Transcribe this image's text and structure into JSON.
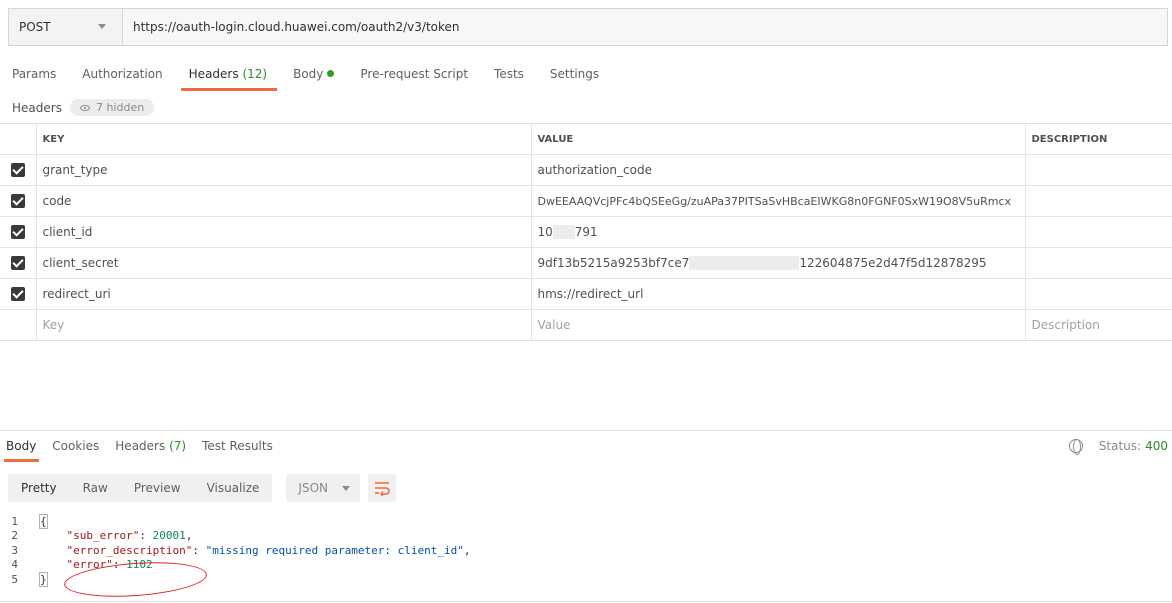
{
  "request": {
    "method": "POST",
    "url": "https://oauth-login.cloud.huawei.com/oauth2/v3/token"
  },
  "tabs": [
    {
      "label": "Params"
    },
    {
      "label": "Authorization"
    },
    {
      "label": "Headers",
      "count": "(12)"
    },
    {
      "label": "Body"
    },
    {
      "label": "Pre-request Script"
    },
    {
      "label": "Tests"
    },
    {
      "label": "Settings"
    }
  ],
  "headers_section": {
    "label": "Headers",
    "hidden": "7 hidden"
  },
  "table": {
    "columns": {
      "key": "KEY",
      "value": "VALUE",
      "description": "DESCRIPTION"
    },
    "rows": [
      {
        "key": "grant_type",
        "value": "authorization_code"
      },
      {
        "key": "code",
        "value": "DwEEAAQVcjPFc4bQSEeGg/zuAPa37PITSaSvHBcaEIWKG8n0FGNF0SxW19O8V5uRmcx"
      },
      {
        "key": "client_id",
        "value_a": "10",
        "value_b": "791"
      },
      {
        "key": "client_secret",
        "value_a": "9df13b5215a9253bf7ce7",
        "value_b": "122604875e2d47f5d12878295"
      },
      {
        "key": "redirect_uri",
        "value": "hms://redirect_url"
      }
    ],
    "placeholders": {
      "key": "Key",
      "value": "Value",
      "description": "Description"
    }
  },
  "response": {
    "tabs": [
      {
        "label": "Body"
      },
      {
        "label": "Cookies"
      },
      {
        "label": "Headers",
        "count": "(7)"
      },
      {
        "label": "Test Results"
      }
    ],
    "status_label": "Status:",
    "status_code": "400",
    "views": [
      "Pretty",
      "Raw",
      "Preview",
      "Visualize"
    ],
    "format": "JSON",
    "lines": [
      {
        "n": "1",
        "brace": "{"
      },
      {
        "n": "2",
        "key": "\"sub_error\"",
        "num": "20001"
      },
      {
        "n": "3",
        "key": "\"error_description\"",
        "str": "\"missing required parameter: client_id\""
      },
      {
        "n": "4",
        "key": "\"error\"",
        "num": "1102"
      },
      {
        "n": "5",
        "brace": "}"
      }
    ]
  }
}
